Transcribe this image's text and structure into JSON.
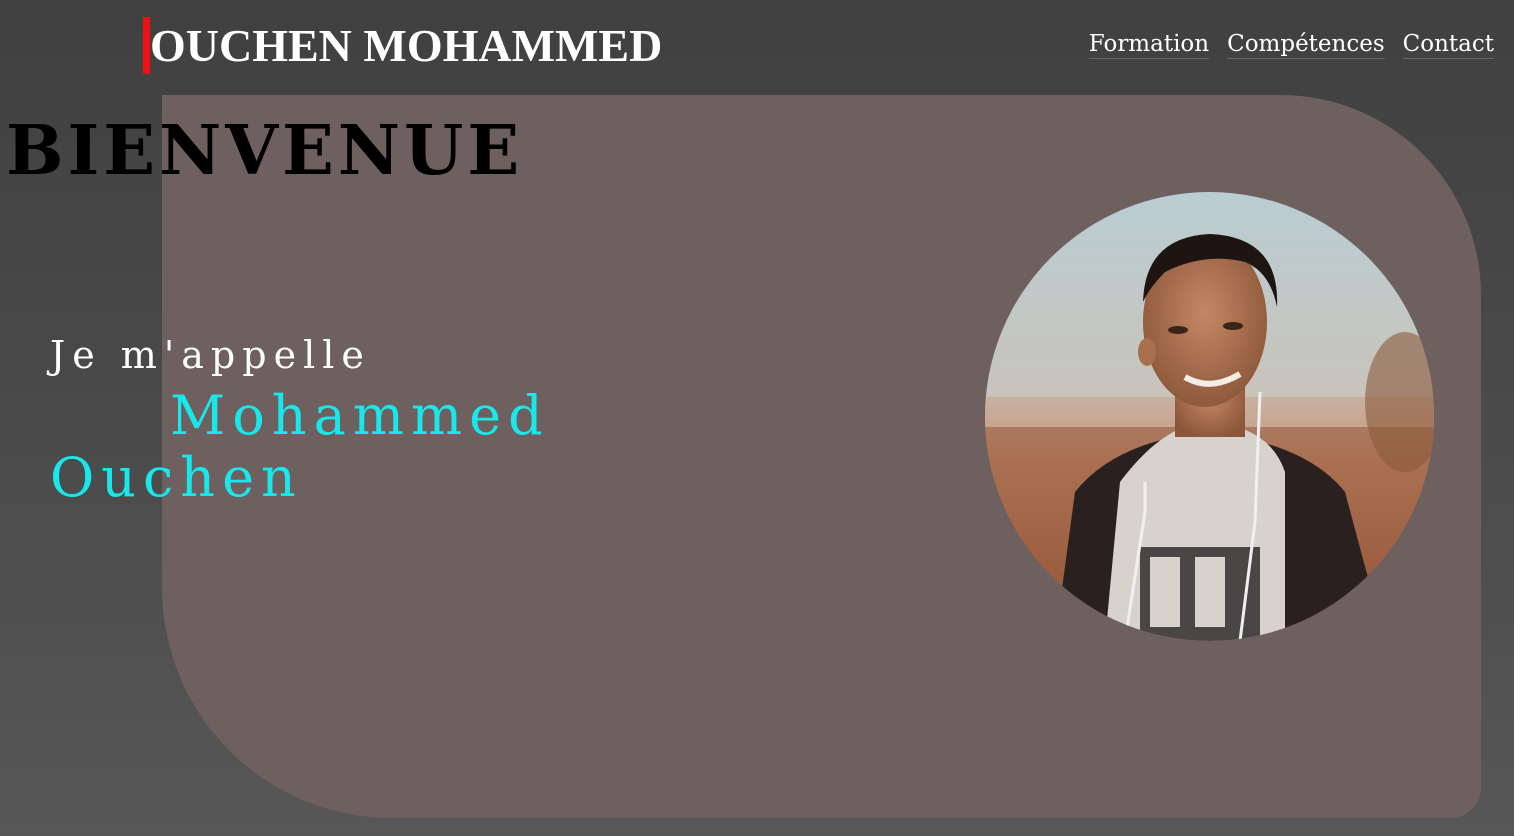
{
  "header": {
    "brand": "OUCHEN MOHAMMED",
    "accent_color": "#ee1111",
    "nav": [
      {
        "label": "Formation"
      },
      {
        "label": "Compétences"
      },
      {
        "label": "Contact"
      }
    ]
  },
  "hero": {
    "welcome": "BIENVENUE",
    "intro": "Je m'appelle",
    "first_name": "Mohammed",
    "last_name": "Ouchen",
    "name_color": "#18e8ec",
    "panel_color": "#6d605e",
    "photo_icon": "profile-photo"
  }
}
